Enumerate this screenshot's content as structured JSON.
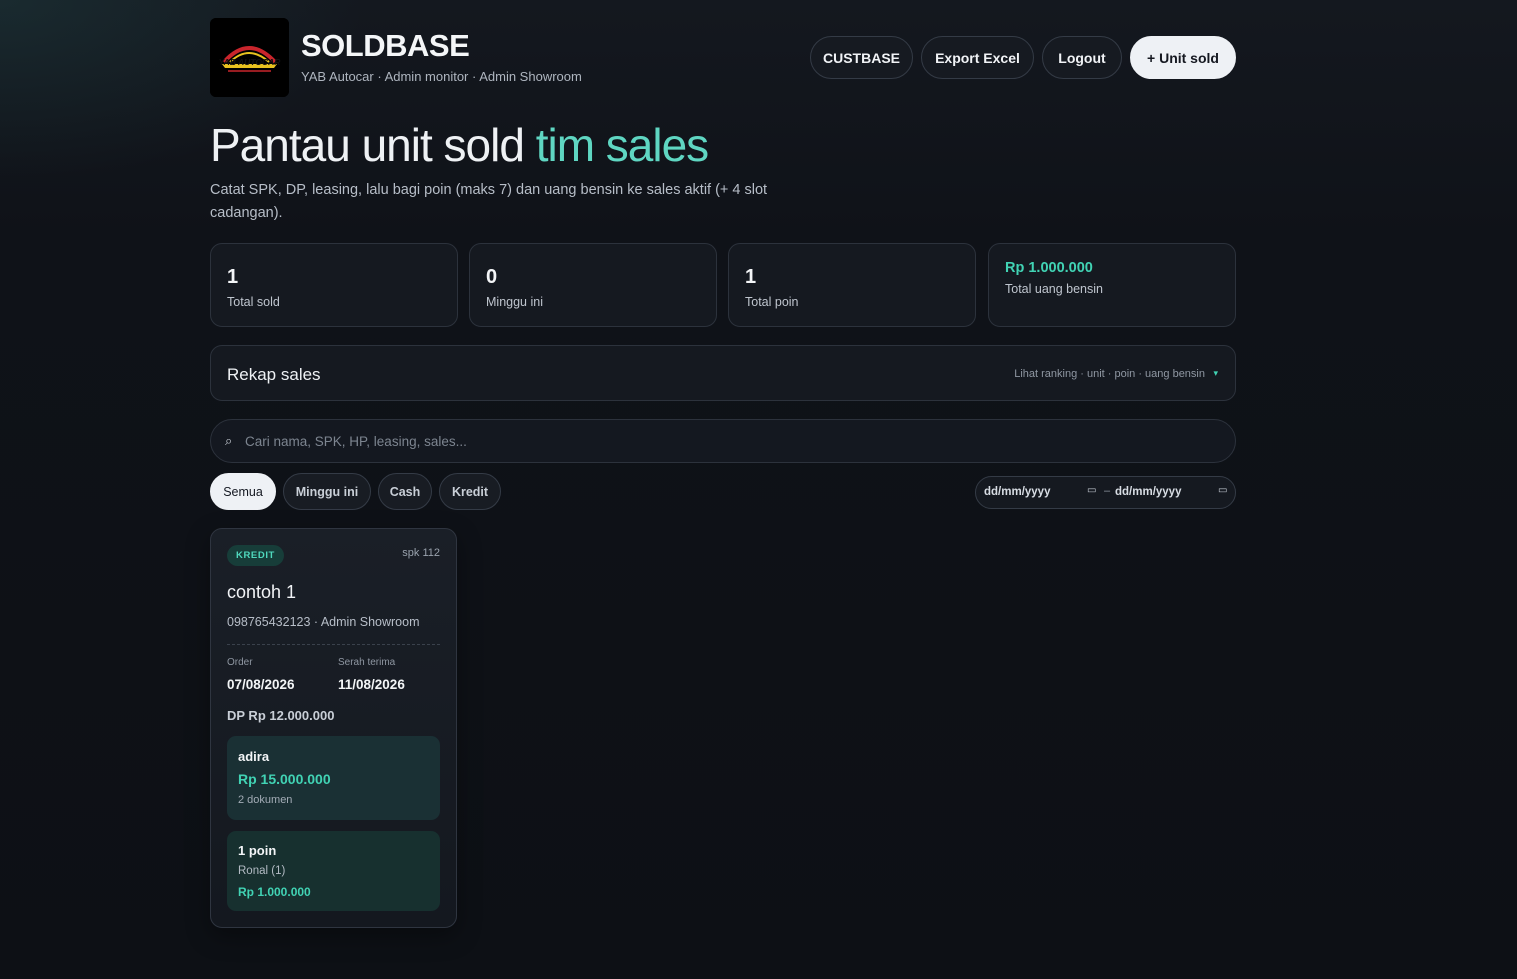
{
  "header": {
    "brand_title": "SOLDBASE",
    "brand_subtitle": "YAB Autocar · Admin monitor · Admin Showroom",
    "logo_text": "YAB AUTOCAR",
    "buttons": {
      "custbase": "CUSTBASE",
      "export": "Export Excel",
      "logout": "Logout",
      "add_unit": "+ Unit sold"
    }
  },
  "hero": {
    "title_main": "Pantau unit sold ",
    "title_accent": "tim sales",
    "description": "Catat SPK, DP, leasing, lalu bagi poin (maks 7) dan uang bensin ke sales aktif (+ 4 slot cadangan)."
  },
  "stats": [
    {
      "value": "1",
      "label": "Total sold"
    },
    {
      "value": "0",
      "label": "Minggu ini"
    },
    {
      "value": "1",
      "label": "Total poin"
    },
    {
      "value": "Rp 1.000.000",
      "label": "Total uang bensin"
    }
  ],
  "rekap": {
    "title": "Rekap sales",
    "hint": "Lihat ranking · unit · poin · uang bensin",
    "caret": "▾"
  },
  "search": {
    "icon": "⌕",
    "placeholder": "Cari nama, SPK, HP, leasing, sales...",
    "value": ""
  },
  "filters": [
    "Semua",
    "Minggu ini",
    "Cash",
    "Kredit"
  ],
  "active_filter": "Semua",
  "date_range": {
    "from": "dd/mm/yyyy",
    "separator": "–",
    "to": "dd/mm/yyyy"
  },
  "cards": [
    {
      "badge": "KREDIT",
      "spk": "spk 112",
      "name": "contoh 1",
      "meta": "098765432123 · Admin Showroom",
      "order_label": "Order",
      "order_date": "07/08/2026",
      "handover_label": "Serah terima",
      "handover_date": "11/08/2026",
      "dp": "DP Rp 12.000.000",
      "leasing": {
        "name": "adira",
        "amount": "Rp 15.000.000",
        "docs": "2 dokumen"
      },
      "points": {
        "title": "1 poin",
        "sales": "Ronal (1)",
        "amount": "Rp 1.000.000"
      }
    }
  ],
  "colors": {
    "accent": "#5fd6c2",
    "money": "#41d3b4",
    "background": "#0e1116"
  }
}
